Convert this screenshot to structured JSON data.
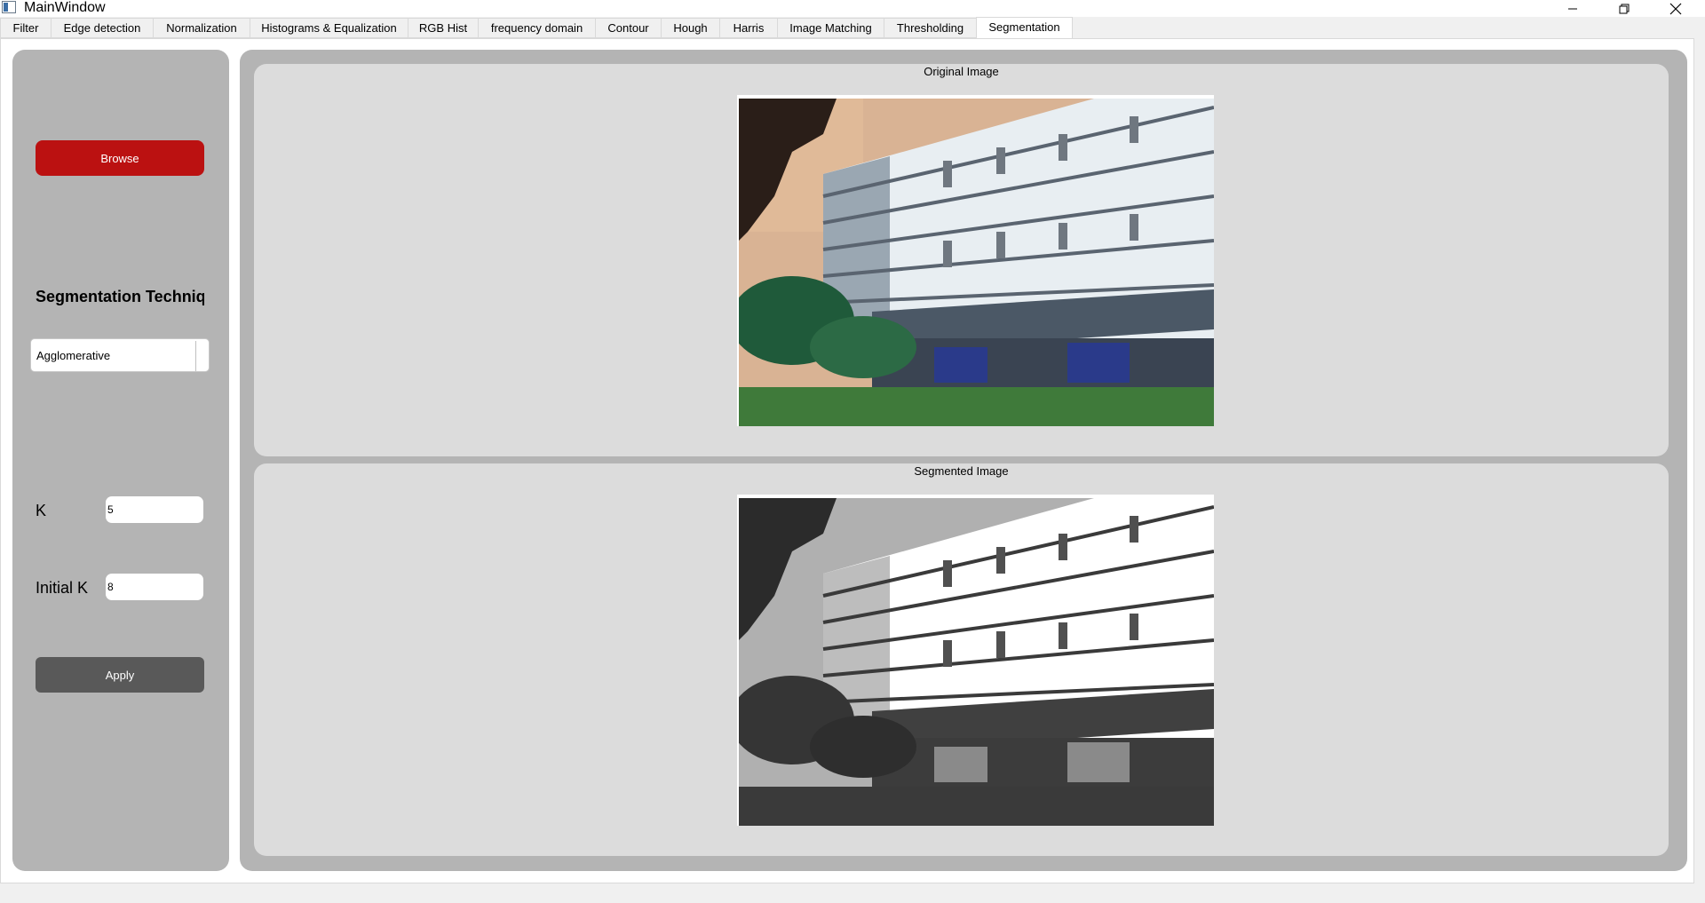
{
  "window": {
    "title": "MainWindow",
    "controls": [
      "minimize-icon",
      "restore-icon",
      "close-icon"
    ]
  },
  "tabs": [
    {
      "label": "Filter",
      "active": false
    },
    {
      "label": "Edge detection",
      "active": false
    },
    {
      "label": "Normalization",
      "active": false
    },
    {
      "label": "Histograms & Equalization",
      "active": false
    },
    {
      "label": "RGB Hist",
      "active": false
    },
    {
      "label": "frequency domain",
      "active": false
    },
    {
      "label": "Contour",
      "active": false
    },
    {
      "label": "Hough",
      "active": false
    },
    {
      "label": "Harris",
      "active": false
    },
    {
      "label": "Image Matching",
      "active": false
    },
    {
      "label": "Thresholding",
      "active": false
    },
    {
      "label": "Segmentation",
      "active": true
    }
  ],
  "controls": {
    "browse_label": "Browse",
    "technique_title": "Segmentation Techniques",
    "technique_value": "Agglomerative",
    "k_label": "K",
    "k_value": "5",
    "initial_k_label": "Initial K",
    "initial_k_value": "8",
    "apply_label": "Apply"
  },
  "images": {
    "original_label": "Original Image",
    "segmented_label": "Segmented Image"
  },
  "colors": {
    "browse": "#bb1111",
    "apply": "#595959",
    "panel": "#b4b4b4",
    "box": "#dcdcdc"
  }
}
